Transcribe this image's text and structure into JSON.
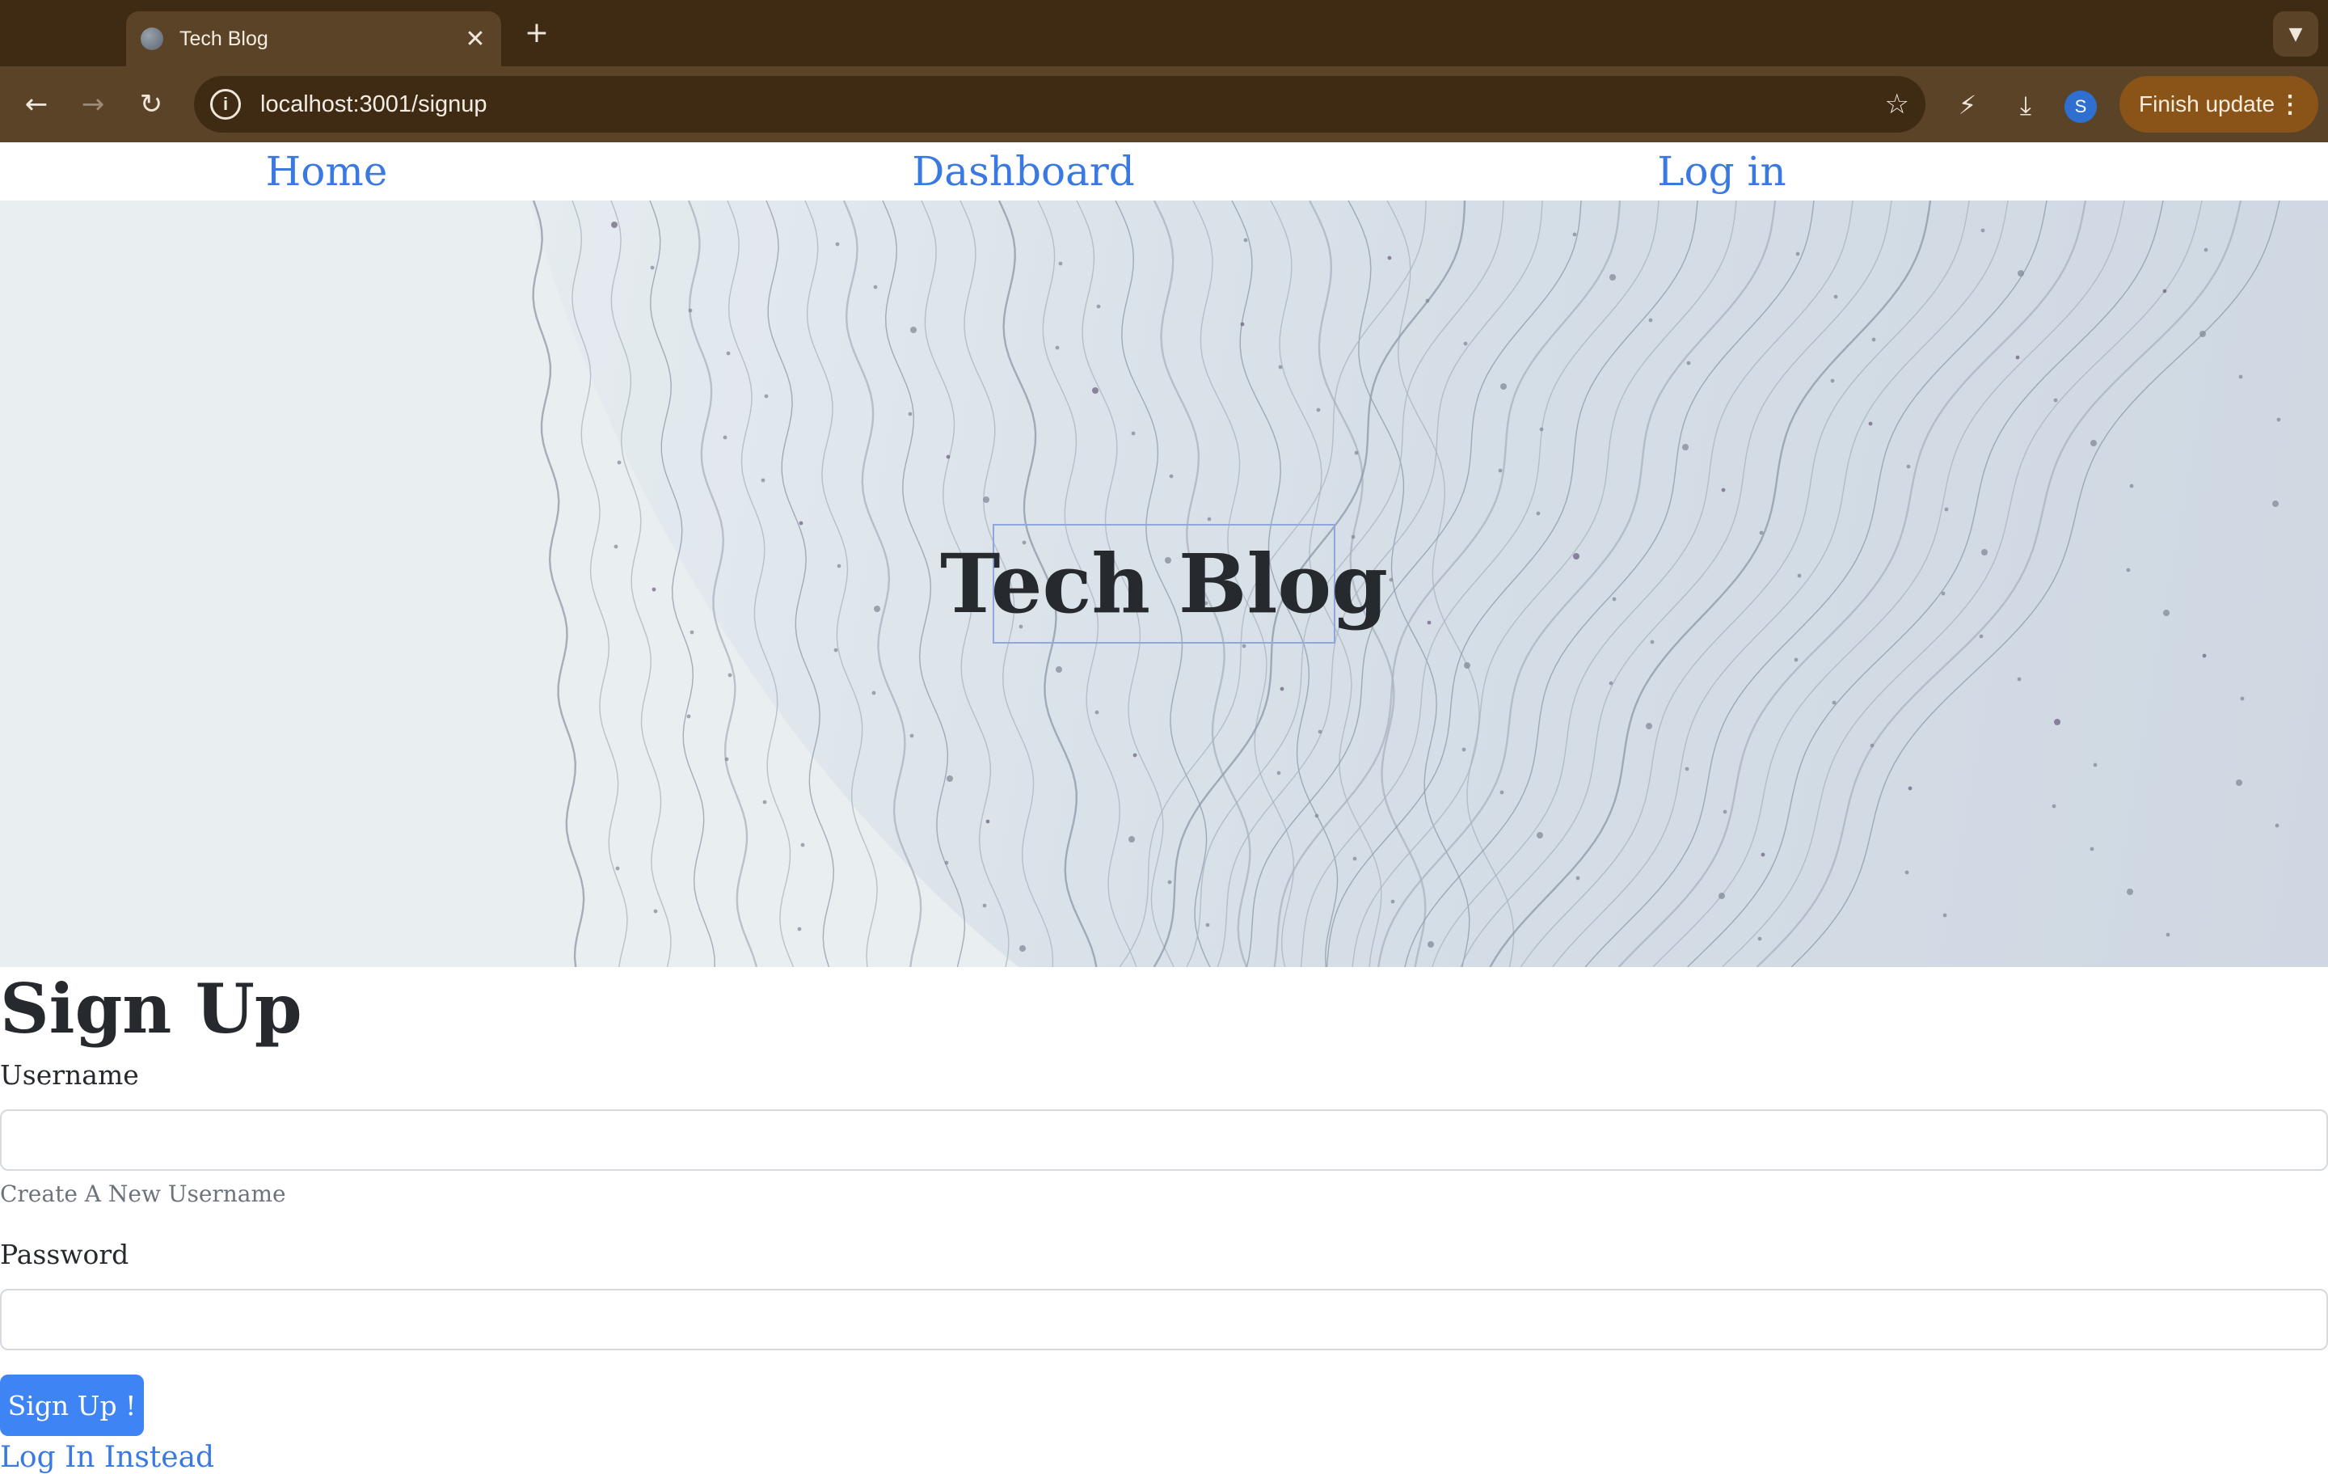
{
  "browser": {
    "tab_title": "Tech Blog",
    "tab_close": "✕",
    "new_tab": "+",
    "url": "localhost:3001/signup",
    "profile_initial": "S",
    "update_label": "Finish update"
  },
  "site_nav": {
    "items": [
      {
        "label": "Home"
      },
      {
        "label": "Dashboard"
      },
      {
        "label": "Log in"
      }
    ]
  },
  "hero": {
    "title": "Tech Blog"
  },
  "form": {
    "heading": "Sign Up",
    "username_label": "Username",
    "username_value": "",
    "username_help": "Create A New Username",
    "password_label": "Password",
    "password_value": "",
    "submit_label": "Sign Up !",
    "login_link": "Log In Instead"
  },
  "colors": {
    "accent": "#3f84f4",
    "link": "#3a7ae0",
    "chrome_bg": "#3f2b14",
    "toolbar_bg": "#5b4328"
  }
}
